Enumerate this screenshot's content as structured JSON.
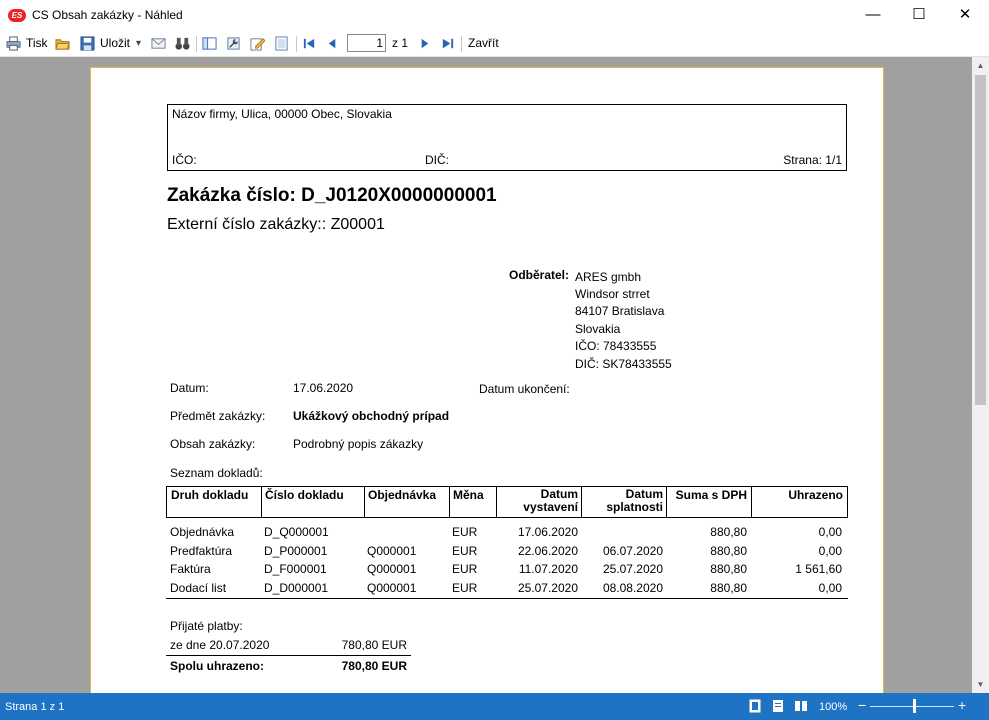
{
  "window": {
    "app_icon_text": "ES",
    "title": "CS Obsah zakázky - Náhled",
    "minimize": "—",
    "maximize": "☐",
    "close": "✕"
  },
  "toolbar": {
    "print_label": "Tisk",
    "save_label": "Uložit",
    "dropdown_arrow": "▾",
    "page_current": "1",
    "page_of_label": "z 1",
    "close_label": "Zavřít"
  },
  "report": {
    "header": {
      "company": "Názov firmy, Ulica, 00000 Obec, Slovakia",
      "ico_label": "IČO:",
      "dic_label": "DIČ:",
      "page_label": "Strana: 1/1"
    },
    "title": "Zakázka číslo: D_J0120X0000000001",
    "external_number": "Externí číslo zakázky:: Z00001",
    "customer": {
      "label": "Odběratel:",
      "lines": [
        "ARES gmbh",
        "Windsor strret",
        "84107 Bratislava",
        "Slovakia",
        "IČO: 78433555",
        "DIČ: SK78433555"
      ]
    },
    "date_label": "Datum:",
    "date_value": "17.06.2020",
    "end_date_label": "Datum ukončení:",
    "subject_label": "Předmět zakázky:",
    "subject_value": "Ukážkový obchodný prípad",
    "content_label": "Obsah zakázky:",
    "content_value": "Podrobný popis zákazky",
    "documents_label": "Seznam dokladů:",
    "documents_table": {
      "headers": {
        "type": "Druh dokladu",
        "number": "Číslo dokladu",
        "order": "Objednávka",
        "currency": "Měna",
        "issued_1": "Datum",
        "issued_2": "vystavení",
        "due_1": "Datum",
        "due_2": "splatnosti",
        "total": "Suma s DPH",
        "paid": "Uhrazeno"
      },
      "rows": [
        {
          "type": "Objednávka",
          "number": "D_Q000001",
          "order": "",
          "currency": "EUR",
          "issued": "17.06.2020",
          "due": "",
          "total": "880,80",
          "paid": "0,00"
        },
        {
          "type": "Predfaktúra",
          "number": "D_P000001",
          "order": "Q000001",
          "currency": "EUR",
          "issued": "22.06.2020",
          "due": "06.07.2020",
          "total": "880,80",
          "paid": "0,00"
        },
        {
          "type": "Faktúra",
          "number": "D_F000001",
          "order": "Q000001",
          "currency": "EUR",
          "issued": "11.07.2020",
          "due": "25.07.2020",
          "total": "880,80",
          "paid": "1 561,60"
        },
        {
          "type": "Dodací list",
          "number": "D_D000001",
          "order": "Q000001",
          "currency": "EUR",
          "issued": "25.07.2020",
          "due": "08.08.2020",
          "total": "880,80",
          "paid": "0,00"
        }
      ]
    },
    "payments": {
      "label": "Přijaté platby:",
      "rows": [
        {
          "date": "ze dne 20.07.2020",
          "amount": "780,80 EUR"
        }
      ],
      "total_label": "Spolu uhrazeno:",
      "total_value": "780,80 EUR"
    }
  },
  "statusbar": {
    "page_info": "Strana 1 z 1",
    "zoom": "100%",
    "zoom_minus": "−",
    "zoom_plus": "+",
    "zoom_level": 0.52
  }
}
